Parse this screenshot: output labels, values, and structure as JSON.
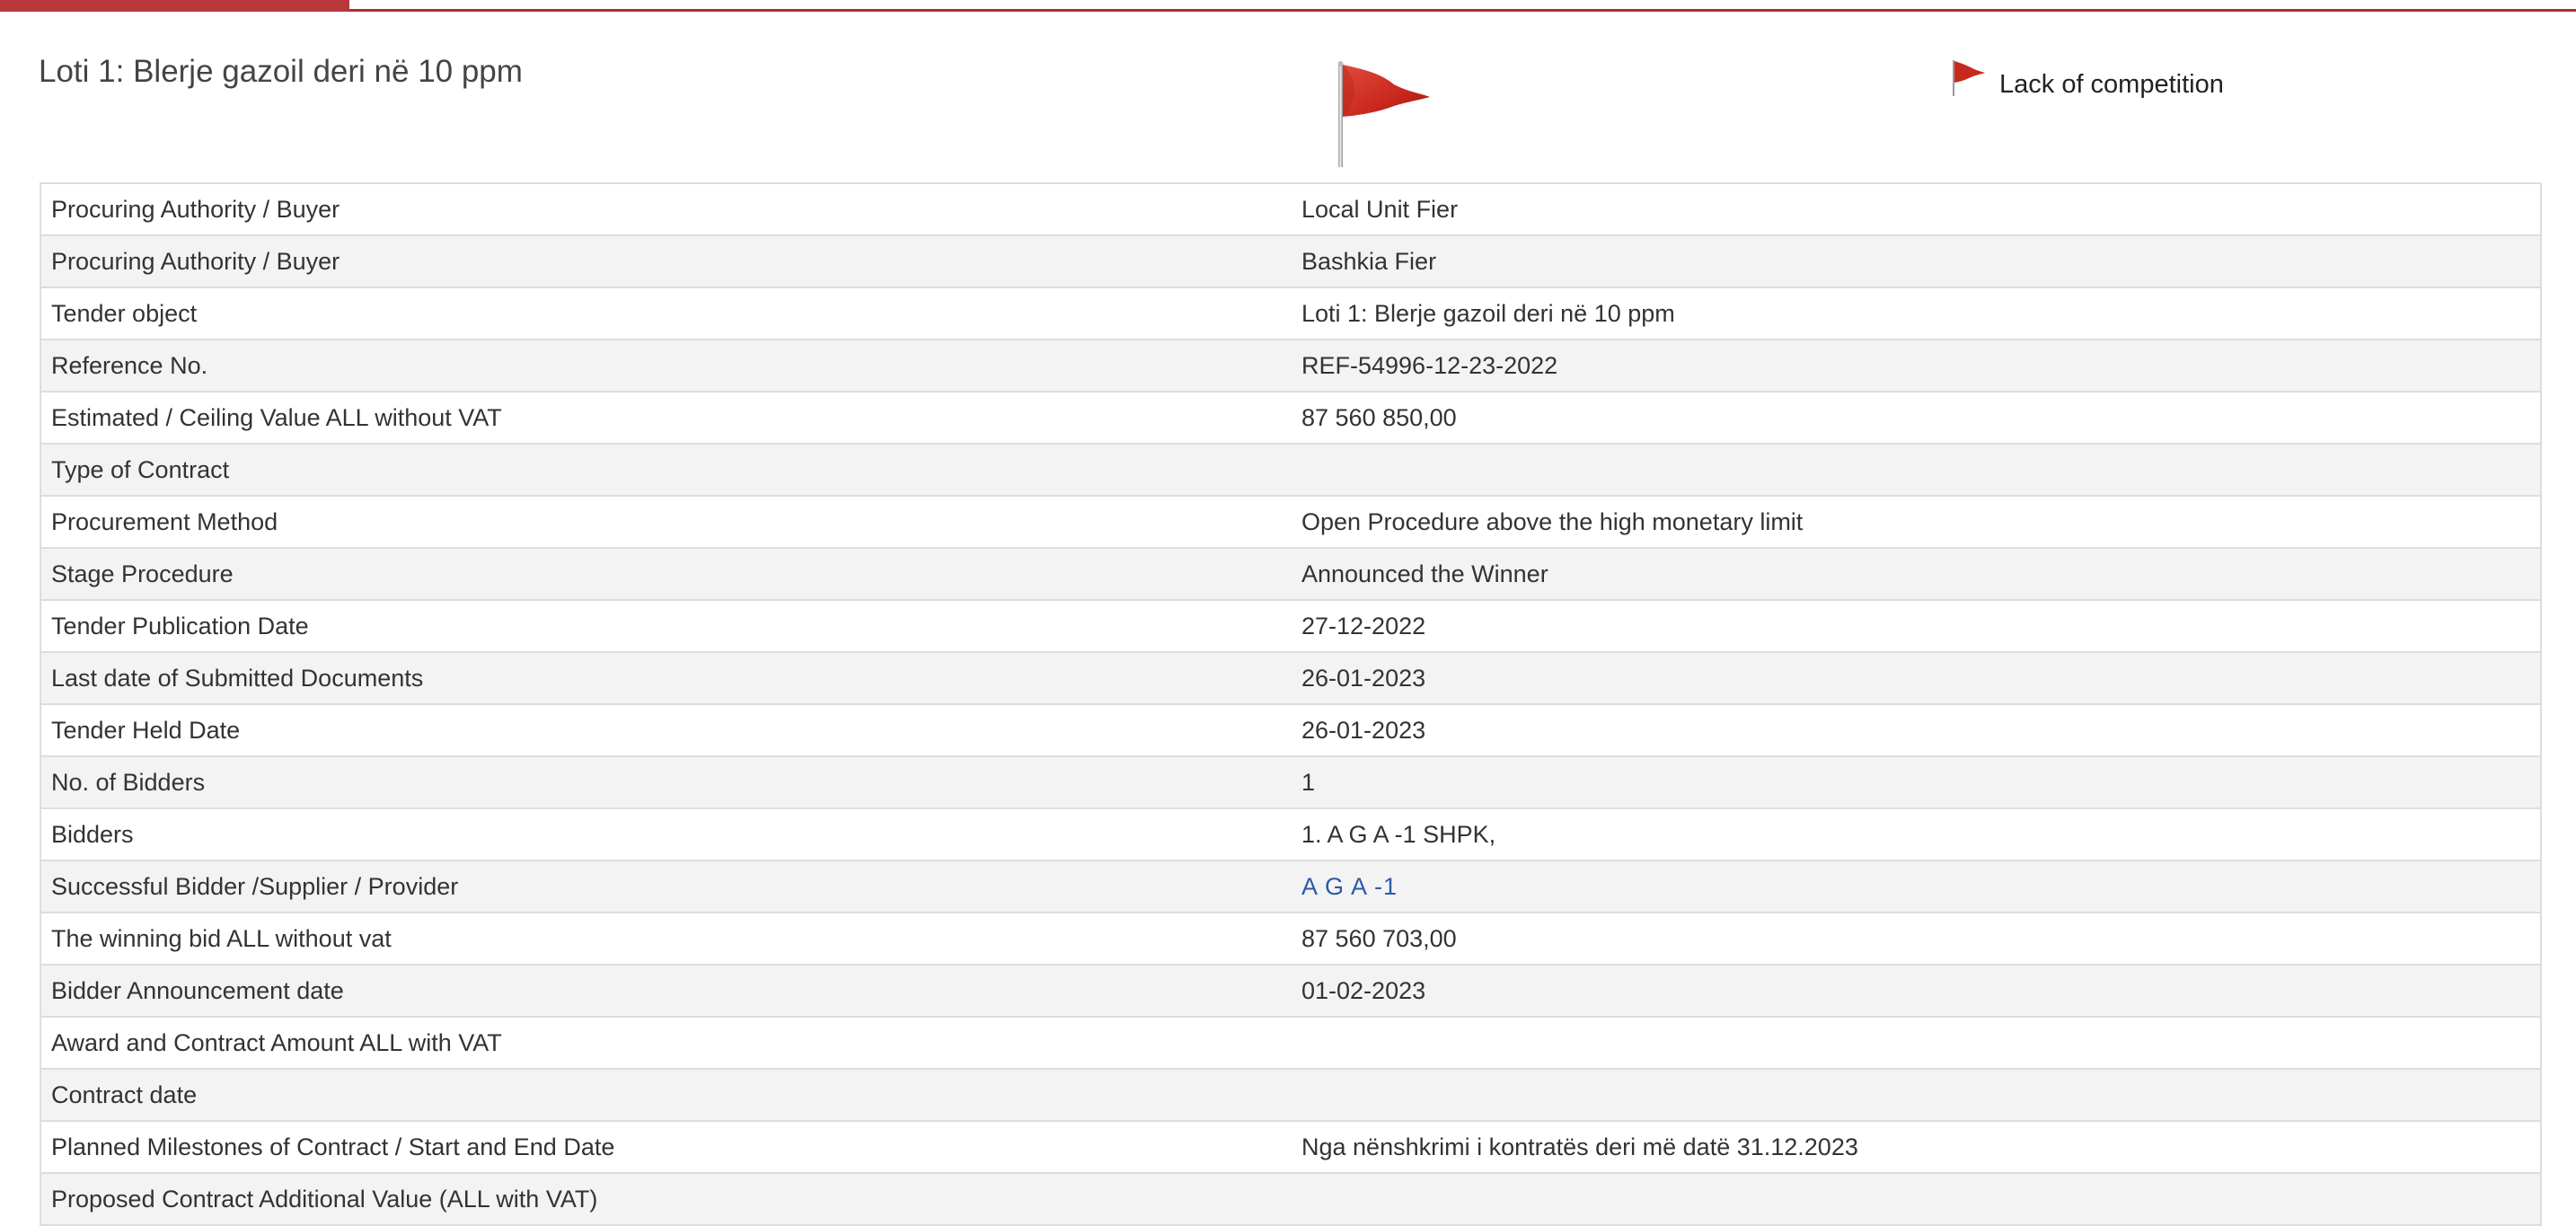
{
  "header": {
    "title": "Loti 1: Blerje gazoil deri në 10 ppm",
    "flag_legend": "Lack of competition",
    "flag_icon": "red-flag-icon",
    "accent_color": "#b8373b",
    "link_color": "#2a5aa8"
  },
  "details": {
    "rows": [
      {
        "label": "Procuring Authority / Buyer",
        "value": "Local Unit Fier"
      },
      {
        "label": "Procuring Authority / Buyer",
        "value": "Bashkia Fier"
      },
      {
        "label": "Tender object",
        "value": "Loti 1: Blerje gazoil deri në 10 ppm"
      },
      {
        "label": "Reference No.",
        "value": "REF-54996-12-23-2022"
      },
      {
        "label": "Estimated / Ceiling Value ALL without VAT",
        "value": "87 560 850,00"
      },
      {
        "label": "Type of Contract",
        "value": ""
      },
      {
        "label": "Procurement Method",
        "value": "Open Procedure above the high monetary limit"
      },
      {
        "label": "Stage Procedure",
        "value": "Announced the Winner"
      },
      {
        "label": "Tender Publication Date",
        "value": "27-12-2022"
      },
      {
        "label": "Last date of Submitted Documents",
        "value": "26-01-2023"
      },
      {
        "label": "Tender Held Date",
        "value": "26-01-2023"
      },
      {
        "label": "No. of Bidders",
        "value": "1"
      },
      {
        "label": "Bidders",
        "value": "1. A G A -1 SHPK,"
      },
      {
        "label": "Successful Bidder /Supplier / Provider",
        "value": "A G A -1"
      },
      {
        "label": "The winning bid ALL without vat",
        "value": "87 560 703,00"
      },
      {
        "label": "Bidder Announcement date",
        "value": "01-02-2023"
      },
      {
        "label": "Award and Contract Amount ALL with VAT",
        "value": ""
      },
      {
        "label": "Contract date",
        "value": ""
      },
      {
        "label": "Planned Milestones of Contract / Start and End Date",
        "value": "Nga nënshkrimi i kontratës deri më datë 31.12.2023"
      },
      {
        "label": "Proposed Contract Additional Value (ALL with VAT)",
        "value": ""
      }
    ]
  }
}
